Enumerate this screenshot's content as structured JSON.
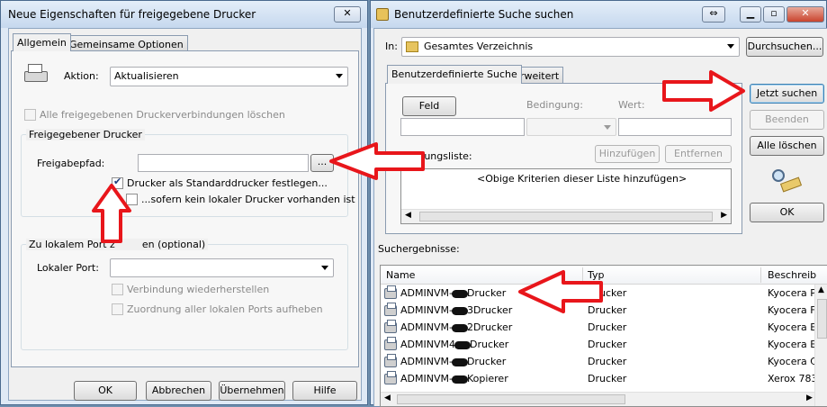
{
  "left_window": {
    "title": "Neue Eigenschaften für freigegebene Drucker",
    "close_glyph": "✕",
    "tabs": [
      "Allgemein",
      "Gemeinsame Optionen"
    ],
    "action_label": "Aktion:",
    "action_value": "Aktualisieren",
    "delete_all_label": "Alle freigegebenen Druckerverbindungen löschen",
    "shared_printer_group": "Freigegebener Drucker",
    "share_path_label": "Freigabepfad:",
    "share_path_value": "",
    "browse_label": "...",
    "set_default_label": "Drucker als Standarddrucker festlegen...",
    "set_default_checked": true,
    "if_no_local_label": "...sofern kein lokaler Drucker vorhanden ist",
    "local_port_group_a": "Zu lokalem Port z",
    "local_port_group_b": "en (optional)",
    "local_port_label": "Lokaler Port:",
    "local_port_value": "",
    "reconnect_label": "Verbindung wiederherstellen",
    "assign_all_label": "Zuordnung aller lokalen Ports aufheben",
    "buttons": {
      "ok": "OK",
      "cancel": "Abbrechen",
      "apply": "Übernehmen",
      "help": "Hilfe"
    }
  },
  "right_window": {
    "title": "Benutzerdefinierte Suche suchen",
    "in_label": "In:",
    "in_value": "Gesamtes Verzeichnis",
    "browse_label": "Durchsuchen...",
    "tabs": [
      "Benutzerdefinierte Suche",
      "Erweitert"
    ],
    "field_label": "Feld",
    "condition_label": "Bedingung:",
    "value_label": "Wert:",
    "add_label": "Hinzufügen",
    "remove_label": "Entfernen",
    "criteria_label_a": "Be",
    "criteria_label_b": "ungsliste:",
    "criteria_placeholder": "<Obige Kriterien dieser Liste hinzufügen>",
    "search_now": "Jetzt suchen",
    "stop": "Beenden",
    "clear_all": "Alle löschen",
    "ok": "OK",
    "results_label": "Suchergebnisse:",
    "columns": [
      "Name",
      "Typ",
      "Beschreib"
    ],
    "rows": [
      {
        "name_a": "ADMINVM-",
        "name_b": "Drucker",
        "type": "Drucker",
        "desc": "Kyocera P"
      },
      {
        "name_a": "ADMINVM-",
        "name_b": "3Drucker",
        "type": "Drucker",
        "desc": "Kyocera F"
      },
      {
        "name_a": "ADMINVM-",
        "name_b": "2Drucker",
        "type": "Drucker",
        "desc": "Kyocera E"
      },
      {
        "name_a": "ADMINVM4",
        "name_b": "Drucker",
        "type": "Drucker",
        "desc": "Kyocera E"
      },
      {
        "name_a": "ADMINVM-",
        "name_b": "Drucker",
        "type": "Drucker",
        "desc": "Kyocera C"
      },
      {
        "name_a": "ADMINVM-",
        "name_b": "Kopierer",
        "type": "Drucker",
        "desc": "Xerox 783"
      }
    ]
  },
  "colors": {
    "arrow": "#e8161b",
    "window_frame": "#dfe9f5",
    "background": "#6f8fae"
  }
}
